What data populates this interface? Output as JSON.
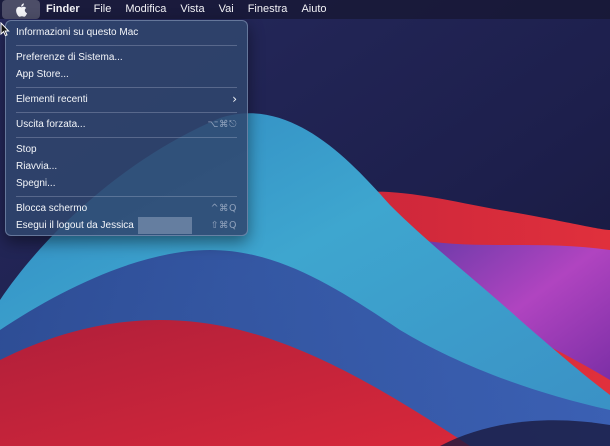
{
  "menubar": {
    "apple_icon": "apple-logo-icon",
    "items": [
      "Finder",
      "File",
      "Modifica",
      "Vista",
      "Vai",
      "Finestra",
      "Aiuto"
    ]
  },
  "apple_menu": {
    "about": "Informazioni su questo Mac",
    "system_prefs": "Preferenze di Sistema...",
    "app_store": "App Store...",
    "recent_items": "Elementi recenti",
    "force_quit": "Uscita forzata...",
    "force_quit_shortcut": "⌥⌘⎋",
    "sleep": "Stop",
    "restart": "Riavvia...",
    "shutdown": "Spegni...",
    "lock_screen": "Blocca schermo",
    "lock_screen_shortcut": "^⌘Q",
    "logout": "Esegui il logout da Jessica",
    "logout_shortcut": "⇧⌘Q"
  },
  "colors": {
    "menu_background": "#30466e",
    "desktop_navy": "#1b1e4a",
    "wave_cyan": "#3aa0c8",
    "wave_red": "#d02a3c",
    "wave_purple": "#7a3aa0"
  }
}
